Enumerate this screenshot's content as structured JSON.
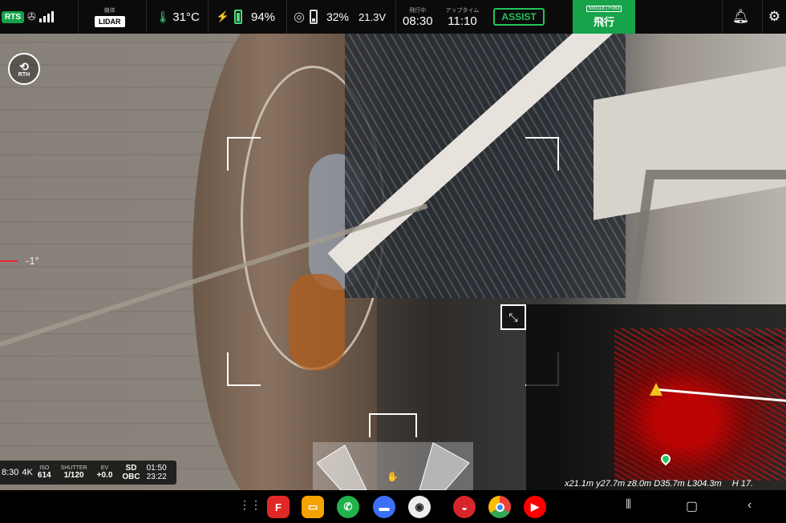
{
  "topbar": {
    "rts": "RTS",
    "mode_label": "機体",
    "mode_value": "LIDAR",
    "temperature": "31°C",
    "battery_percent": "94%",
    "rc_battery_percent": "32%",
    "voltage": "21.3V",
    "flight_time_label": "飛行中",
    "flight_time": "08:30",
    "uptime_label": "アップタイム",
    "uptime": "11:10",
    "assist_label": "ASSIST",
    "flight_id": "S00118 | F063",
    "flight_status": "飛行",
    "icons": [
      "rc-icon",
      "satellite-icon",
      "signal-icon",
      "thermometer-icon",
      "drone-battery-icon",
      "battery-icon",
      "radar-icon",
      "battery-icon",
      "bell-icon",
      "gear-icon"
    ]
  },
  "overlays": {
    "rth_label": "RTH",
    "pitch_value": "-1°"
  },
  "camera": {
    "record_time": "8:30",
    "resolution": "4K",
    "iso_label": "ISO",
    "iso_value": "614",
    "shutter_label": "SHUTTER",
    "shutter_value": "1/120",
    "ev_label": "EV",
    "ev_value": "+0.0",
    "storage_sd": "SD",
    "storage_obc": "OBC",
    "storage_sd_time": "01:50",
    "storage_obc_time": "23:22"
  },
  "minimap": {
    "coords": "x21.1m y27.7m z8.0m D35.7m L304.3m",
    "height": "H 17."
  },
  "navbar": {
    "apps": [
      "apps-grid-icon",
      "flipboard-icon",
      "files-icon",
      "phone-icon",
      "messages-icon",
      "camera-icon",
      "app-icon",
      "chrome-icon",
      "youtube-icon"
    ],
    "system": [
      "recents-icon",
      "home-icon",
      "back-icon"
    ]
  },
  "colors": {
    "accent_green": "#16a34a",
    "assist_green": "#22c55e",
    "pitch_red": "#ee2233",
    "drone_marker": "#f0c419"
  }
}
